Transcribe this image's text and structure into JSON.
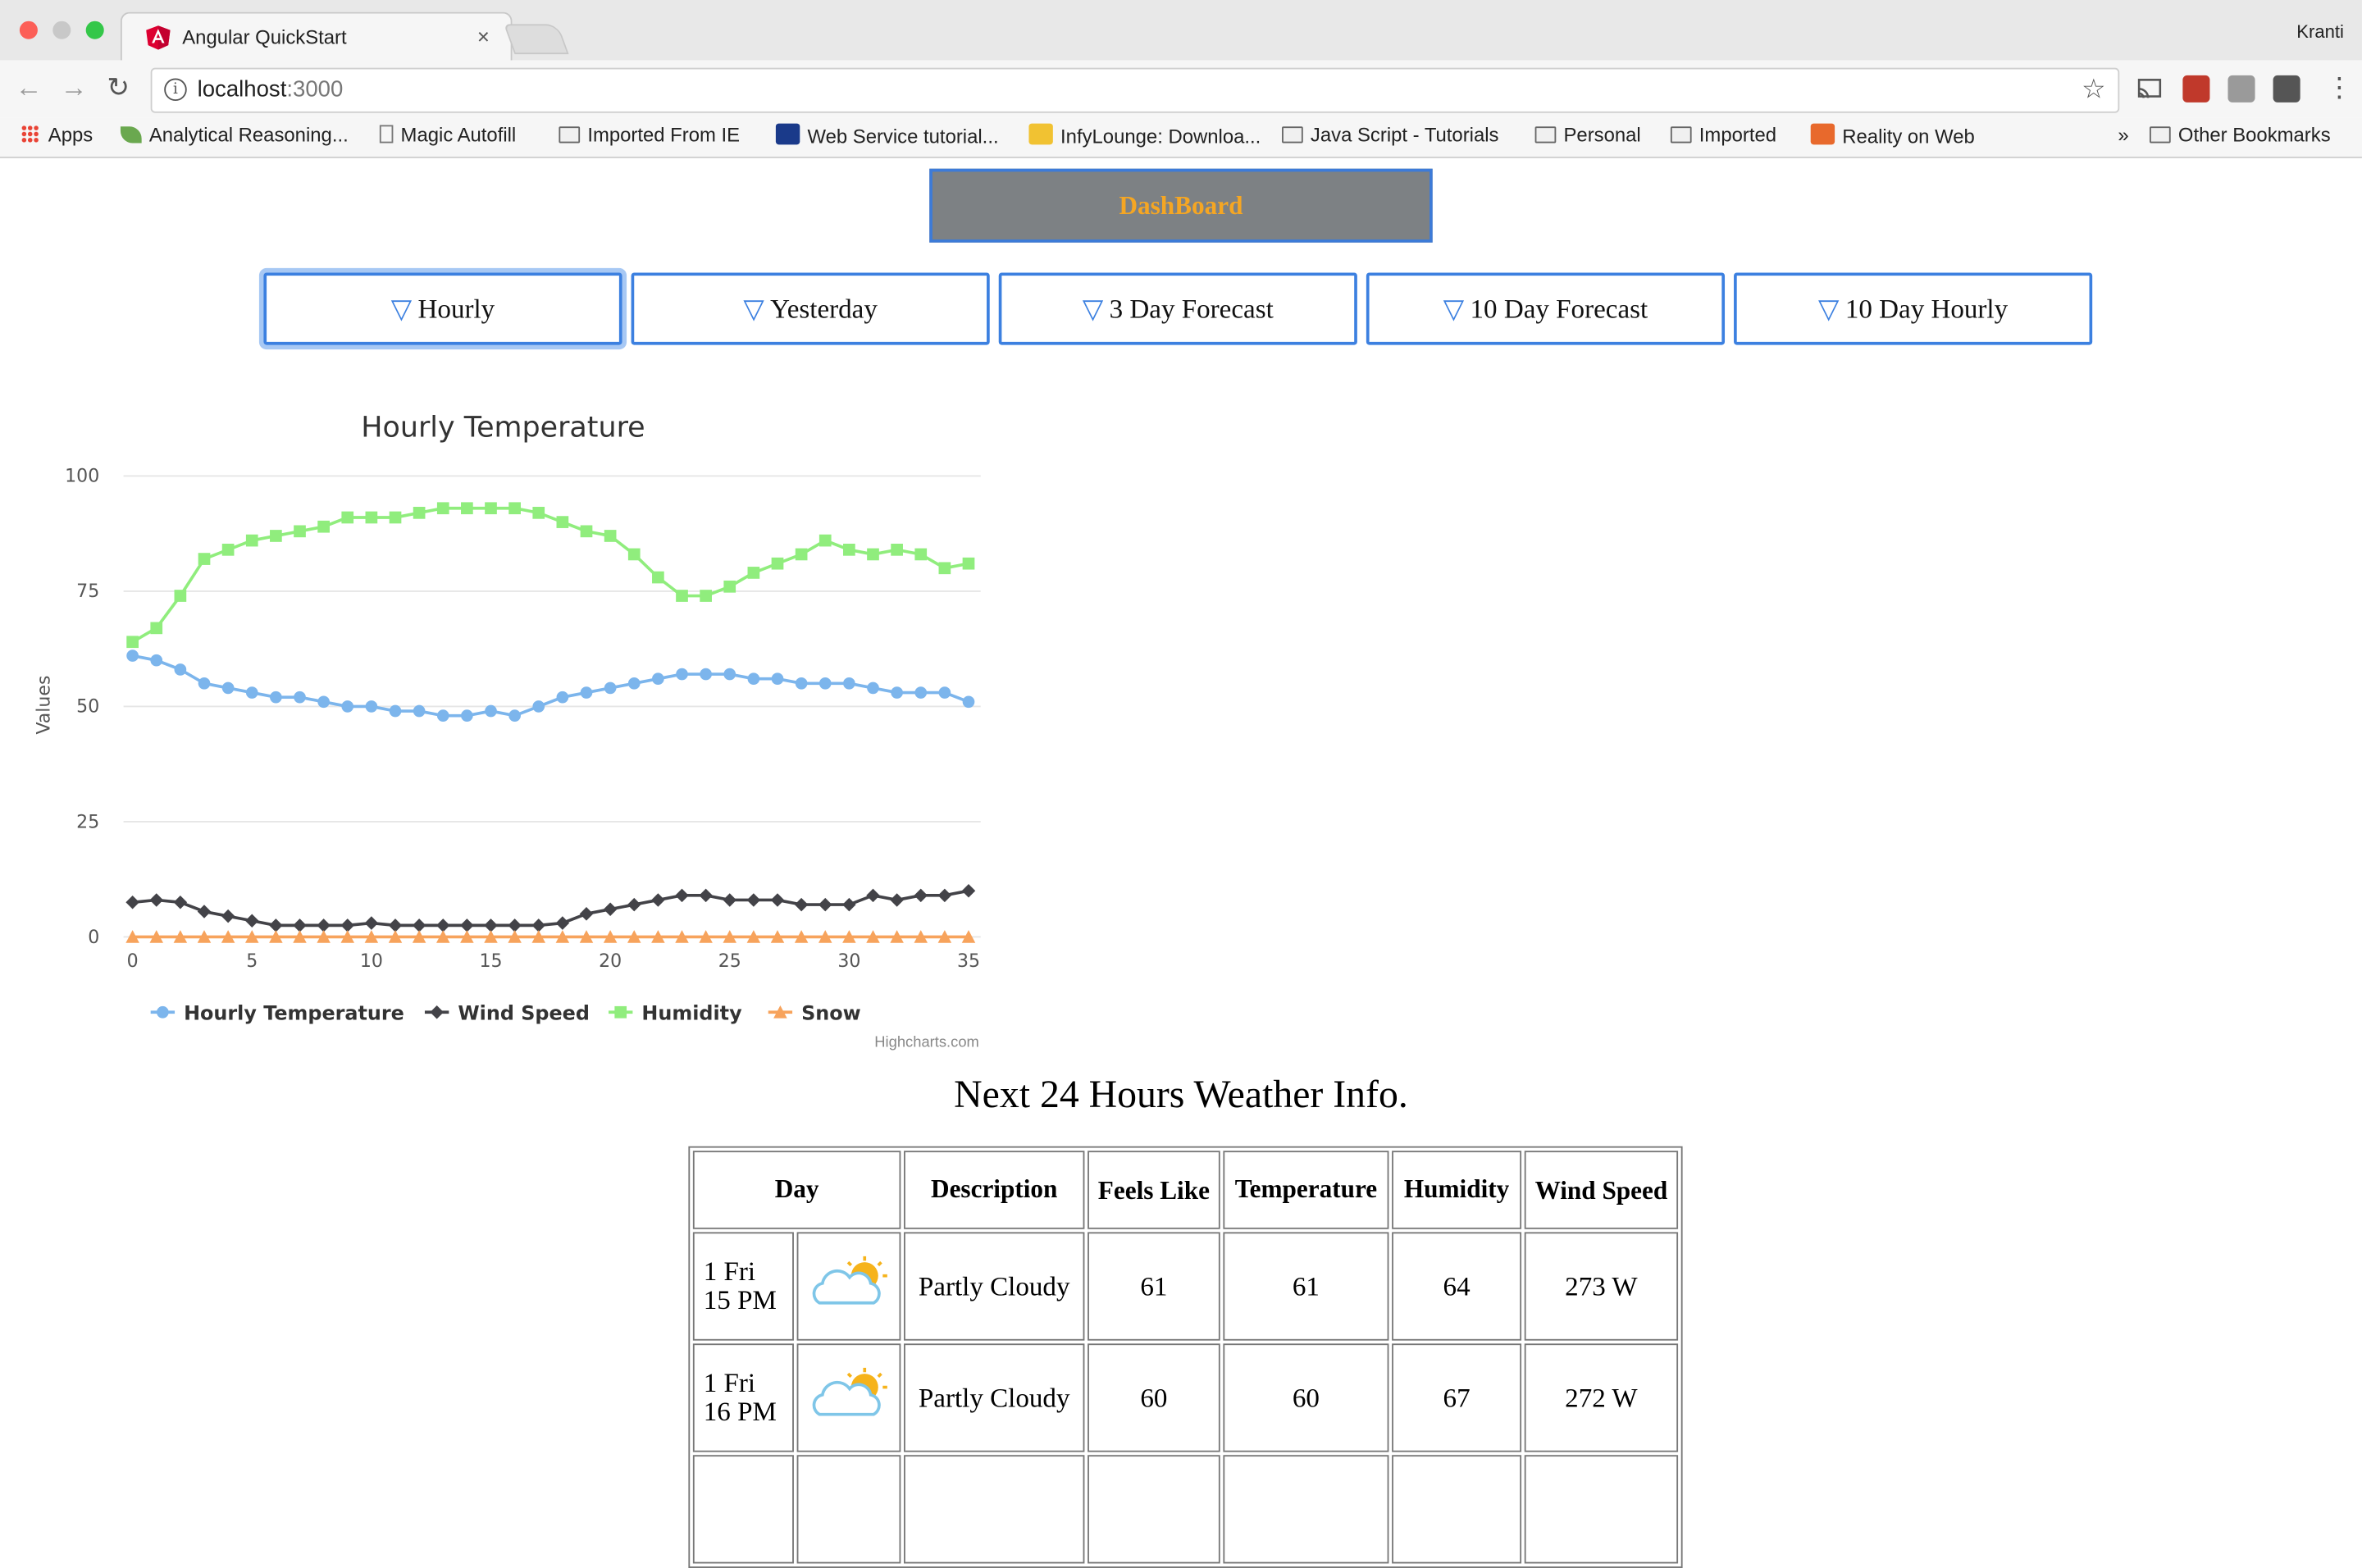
{
  "browser": {
    "tab_title": "Angular QuickStart",
    "tab_close": "×",
    "profile_name": "Kranti",
    "url_host": "localhost",
    "url_port": ":3000",
    "bookmarks": [
      {
        "label": "Apps",
        "icon": "apps-grid-icon"
      },
      {
        "label": "Analytical Reasoning...",
        "icon": "leaf-icon"
      },
      {
        "label": "Magic Autofill",
        "icon": "page-icon"
      },
      {
        "label": "Imported From IE",
        "icon": "folder-icon"
      },
      {
        "label": "Web Service tutorial...",
        "icon": "am-logo-icon"
      },
      {
        "label": "InfyLounge: Downloa...",
        "icon": "il-logo-icon"
      },
      {
        "label": "Java Script - Tutorials",
        "icon": "folder-icon"
      },
      {
        "label": "Personal",
        "icon": "folder-icon"
      },
      {
        "label": "Imported",
        "icon": "folder-icon"
      },
      {
        "label": "Reality on Web",
        "icon": "code-icon"
      }
    ],
    "overflow": "»",
    "other_bookmarks": "Other Bookmarks"
  },
  "page": {
    "dashboard_label": "DashBoard",
    "tabs": [
      {
        "label": "Hourly",
        "icon": "triangle-down-icon",
        "active": true
      },
      {
        "label": "Yesterday",
        "icon": "triangle-down-icon"
      },
      {
        "label": "3 Day Forecast",
        "icon": "triangle-down-icon"
      },
      {
        "label": "10 Day Forecast",
        "icon": "triangle-down-icon"
      },
      {
        "label": "10 Day Hourly",
        "icon": "triangle-down-icon"
      }
    ],
    "table_title": "Next 24 Hours Weather Info.",
    "table": {
      "headers": [
        "Day",
        "Description",
        "Feels Like",
        "Temperature",
        "Humidity",
        "Wind Speed"
      ],
      "rows": [
        {
          "day": "1 Fri",
          "hour": "15 PM",
          "icon": "partly-cloudy-icon",
          "description": "Partly Cloudy",
          "feels_like": "61",
          "temperature": "61",
          "humidity": "64",
          "wind": "273 W"
        },
        {
          "day": "1 Fri",
          "hour": "16 PM",
          "icon": "partly-cloudy-icon",
          "description": "Partly Cloudy",
          "feels_like": "60",
          "temperature": "60",
          "humidity": "67",
          "wind": "272 W"
        }
      ]
    }
  },
  "chart_data": {
    "type": "line",
    "title": "Hourly Temperature",
    "ylabel": "Values",
    "xlabel": "",
    "xlim": [
      0,
      35
    ],
    "ylim": [
      0,
      100
    ],
    "x_ticks": [
      0,
      5,
      10,
      15,
      20,
      25,
      30,
      35
    ],
    "y_ticks": [
      0,
      25,
      50,
      75,
      100
    ],
    "grid": true,
    "legend_position": "bottom",
    "credits": "Highcharts.com",
    "series": [
      {
        "name": "Hourly Temperature",
        "color": "#7cb5ec",
        "marker": "circle",
        "values": [
          61,
          60,
          58,
          55,
          54,
          53,
          52,
          52,
          51,
          50,
          50,
          49,
          49,
          48,
          48,
          49,
          48,
          50,
          52,
          53,
          54,
          55,
          56,
          57,
          57,
          57,
          56,
          56,
          55,
          55,
          55,
          54,
          53,
          53,
          53,
          51
        ]
      },
      {
        "name": "Wind Speed",
        "color": "#434348",
        "marker": "diamond",
        "values": [
          7.5,
          8,
          7.5,
          5.5,
          4.5,
          3.5,
          2.5,
          2.5,
          2.5,
          2.5,
          3,
          2.5,
          2.5,
          2.5,
          2.5,
          2.5,
          2.5,
          2.5,
          3,
          5,
          6,
          7,
          8,
          9,
          9,
          8,
          8,
          8,
          7,
          7,
          7,
          9,
          8,
          9,
          9,
          10
        ]
      },
      {
        "name": "Humidity",
        "color": "#90ed7d",
        "marker": "square",
        "values": [
          64,
          67,
          74,
          82,
          84,
          86,
          87,
          88,
          89,
          91,
          91,
          91,
          92,
          93,
          93,
          93,
          93,
          92,
          90,
          88,
          87,
          83,
          78,
          74,
          74,
          76,
          79,
          81,
          83,
          86,
          84,
          83,
          84,
          83,
          80,
          81
        ]
      },
      {
        "name": "Snow",
        "color": "#f7a35c",
        "marker": "triangle",
        "values": [
          0,
          0,
          0,
          0,
          0,
          0,
          0,
          0,
          0,
          0,
          0,
          0,
          0,
          0,
          0,
          0,
          0,
          0,
          0,
          0,
          0,
          0,
          0,
          0,
          0,
          0,
          0,
          0,
          0,
          0,
          0,
          0,
          0,
          0,
          0,
          0
        ]
      }
    ]
  }
}
